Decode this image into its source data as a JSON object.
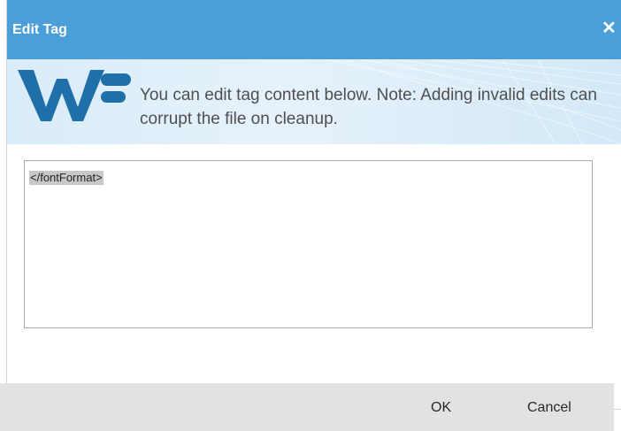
{
  "dialog": {
    "title": "Edit Tag",
    "close_label": "✕",
    "banner": {
      "logo_icon": "wf-logo-icon",
      "message": "You can edit tag content below. Note: Adding invalid edits can corrupt the file on cleanup."
    },
    "editor": {
      "value": "</fontFormat>"
    },
    "buttons": {
      "ok_label": "OK",
      "cancel_label": "Cancel"
    }
  },
  "colors": {
    "titlebar": "#4a9fd8",
    "banner": "#dcedf9",
    "logo": "#1f6fa8",
    "footer": "#e2e2e4"
  }
}
